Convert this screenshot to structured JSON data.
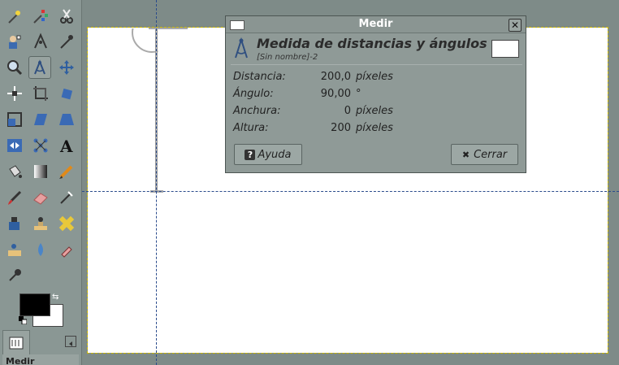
{
  "dialog": {
    "title": "Medir",
    "header_title": "Medida de distancias y ángulos",
    "header_subtitle": "[Sin nombre]-2",
    "rows": [
      {
        "label": "Distancia:",
        "value": "200,0",
        "unit": "píxeles"
      },
      {
        "label": "Ángulo:",
        "value": "90,00",
        "unit": "°"
      },
      {
        "label": "Anchura:",
        "value": "0",
        "unit": "píxeles"
      },
      {
        "label": "Altura:",
        "value": "200",
        "unit": "píxeles"
      }
    ],
    "help_label": "Ayuda",
    "close_label": "Cerrar"
  },
  "toolbox": {
    "options_label": "Medir",
    "colors": {
      "foreground": "#000000",
      "background": "#ffffff"
    }
  },
  "icons": {
    "grid": [
      [
        "fuzzy-select-icon",
        "select-by-color-icon",
        "scissors-select-icon"
      ],
      [
        "foreground-select-icon",
        "paths-icon",
        "color-picker-icon"
      ],
      [
        "zoom-icon",
        "measure-icon",
        "move-icon"
      ],
      [
        "align-icon",
        "crop-icon",
        "rotate-icon"
      ],
      [
        "scale-icon",
        "shear-icon",
        "perspective-icon"
      ],
      [
        "flip-icon",
        "cage-transform-icon",
        "text-icon"
      ],
      [
        "bucket-fill-icon",
        "blend-icon",
        "pencil-icon"
      ],
      [
        "paintbrush-icon",
        "eraser-icon",
        "airbrush-icon"
      ],
      [
        "ink-icon",
        "clone-icon",
        "heal-icon"
      ],
      [
        "perspective-clone-icon",
        "blur-icon",
        "smudge-icon"
      ],
      [
        "dodge-burn-icon"
      ]
    ]
  }
}
